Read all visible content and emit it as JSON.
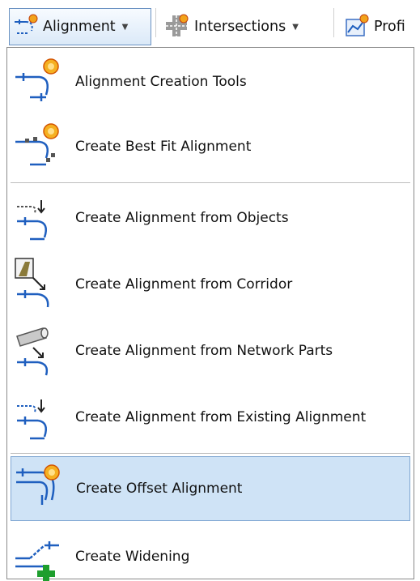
{
  "toolbar": {
    "alignment_label": "Alignment",
    "intersections_label": "Intersections",
    "profile_label": "Profi"
  },
  "menu": {
    "items": [
      {
        "label": "Alignment Creation Tools",
        "icon": "alignment-creation-tools-icon"
      },
      {
        "label": "Create Best Fit Alignment",
        "icon": "best-fit-alignment-icon"
      },
      {
        "label": "Create Alignment from Objects",
        "icon": "alignment-from-objects-icon"
      },
      {
        "label": "Create Alignment from Corridor",
        "icon": "alignment-from-corridor-icon"
      },
      {
        "label": "Create Alignment from Network Parts",
        "icon": "alignment-from-network-parts-icon"
      },
      {
        "label": "Create Alignment from Existing Alignment",
        "icon": "alignment-from-existing-alignment-icon"
      },
      {
        "label": "Create Offset Alignment",
        "icon": "offset-alignment-icon",
        "highlighted": true
      },
      {
        "label": "Create Widening",
        "icon": "widening-icon"
      }
    ]
  },
  "colors": {
    "highlight_fill": "#cfe3f6",
    "highlight_border": "#7fa6d2",
    "icon_blue": "#1f5fbf",
    "icon_star": "#f2a31a",
    "plus_green": "#1e9e2e"
  }
}
